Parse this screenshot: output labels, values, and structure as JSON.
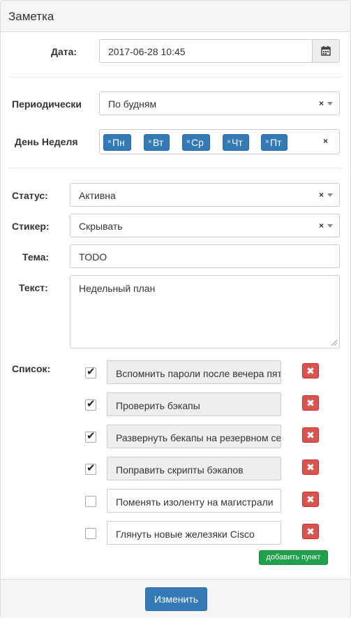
{
  "panel": {
    "title": "Заметка"
  },
  "date": {
    "label": "Дата:",
    "value": "2017-06-28 10:45",
    "icon": "calendar-icon"
  },
  "periodic": {
    "label": "Периодически",
    "value": "По будням",
    "clear": "×"
  },
  "weekdays": {
    "label": "День Неделя",
    "tags": [
      "Пн",
      "Вт",
      "Ср",
      "Чт",
      "Пт"
    ],
    "tag_remove": "×",
    "clear": "×"
  },
  "status": {
    "label": "Статус:",
    "value": "Активна",
    "clear": "×"
  },
  "sticker": {
    "label": "Стикер:",
    "value": "Скрывать",
    "clear": "×"
  },
  "subject": {
    "label": "Тема:",
    "value": "TODO"
  },
  "text": {
    "label": "Текст:",
    "value": "Недельный план"
  },
  "list": {
    "label": "Список:",
    "items": [
      {
        "text": "Вспомнить пароли после вечера пятницы",
        "checked": true
      },
      {
        "text": "Проверить бэкапы",
        "checked": true
      },
      {
        "text": "Развернуть бекапы на резервном сервере",
        "checked": true
      },
      {
        "text": "Поправить скрипты бэкапов",
        "checked": true
      },
      {
        "text": "Поменять изоленту на магистрали",
        "checked": false
      },
      {
        "text": "Глянуть новые железяки Cisco",
        "checked": false
      }
    ],
    "delete_symbol": "✖",
    "check_symbol": "✔",
    "add_label": "добавить пункт"
  },
  "footer": {
    "submit_label": "Изменить"
  },
  "colors": {
    "primary": "#337ab7",
    "danger": "#d9534f",
    "success": "#1fa04a"
  }
}
